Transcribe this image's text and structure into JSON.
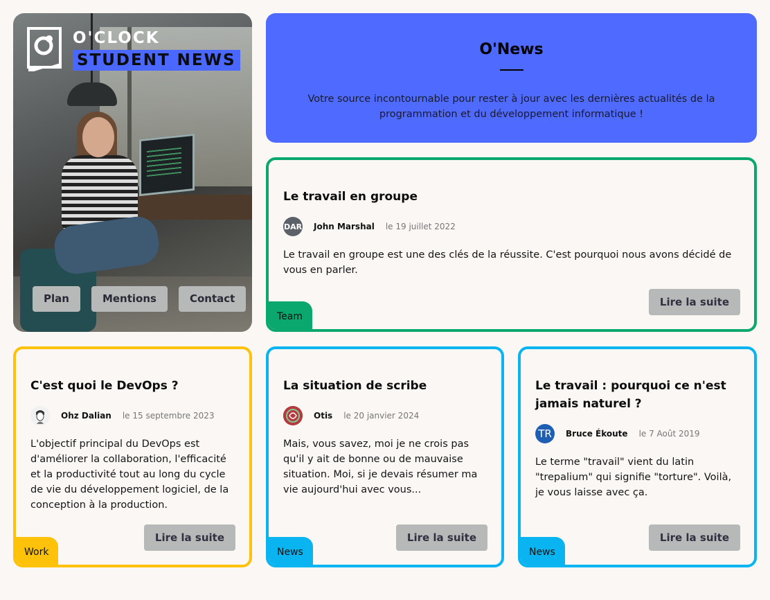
{
  "brand": {
    "line1": "O'CLOCK",
    "line2": "STUDENT NEWS",
    "accent": "#4a68ff"
  },
  "nav": {
    "items": [
      {
        "label": "Plan"
      },
      {
        "label": "Mentions"
      },
      {
        "label": "Contact"
      }
    ]
  },
  "intro": {
    "title": "O'News",
    "description": "Votre source incontournable pour rester à jour avec les dernières actualités de la programmation et du développement informatique !",
    "background": "#4e6aff"
  },
  "articles": [
    {
      "title": "Le travail en groupe",
      "author": "John Marshal",
      "author_initials": "DAR",
      "avatar_color": "#5c6169",
      "date": "le 19 juillet 2022",
      "excerpt": "Le travail en groupe est une des clés de la réussite. C'est pourquoi nous avons décidé de vous en parler.",
      "button": "Lire la suite",
      "tag": "Team",
      "color": "#0aa86e"
    },
    {
      "title": "C'est quoi le DevOps ?",
      "author": "Ohz Dalian",
      "author_initials": "",
      "avatar_color": "#e8e8e8",
      "date": "le 15 septembre 2023",
      "excerpt": "L'objectif principal du DevOps est d'améliorer la collaboration, l'efficacité et la productivité tout au long du cycle de vie du développement logiciel, de la conception à la production.",
      "button": "Lire la suite",
      "tag": "Work",
      "color": "#ffc20a"
    },
    {
      "title": "La situation de scribe",
      "author": "Otis",
      "author_initials": "",
      "avatar_color": "#c0392b",
      "date": "le 20 janvier 2024",
      "excerpt": "Mais, vous savez, moi je ne crois pas qu'il y ait de bonne ou de mauvaise situation. Moi, si je devais résumer ma vie aujourd'hui avec vous...",
      "button": "Lire la suite",
      "tag": "News",
      "color": "#0ab4f0"
    },
    {
      "title": "Le travail : pourquoi ce n'est jamais naturel ?",
      "author": "Bruce Ékoute",
      "author_initials": "TR",
      "avatar_color": "#1e5fb4",
      "date": "le 7 Août 2019",
      "excerpt": "Le terme \"travail\" vient du latin \"trepalium\" qui signifie \"torture\". Voilà, je vous laisse avec ça.",
      "button": "Lire la suite",
      "tag": "News",
      "color": "#0ab4f0"
    }
  ]
}
